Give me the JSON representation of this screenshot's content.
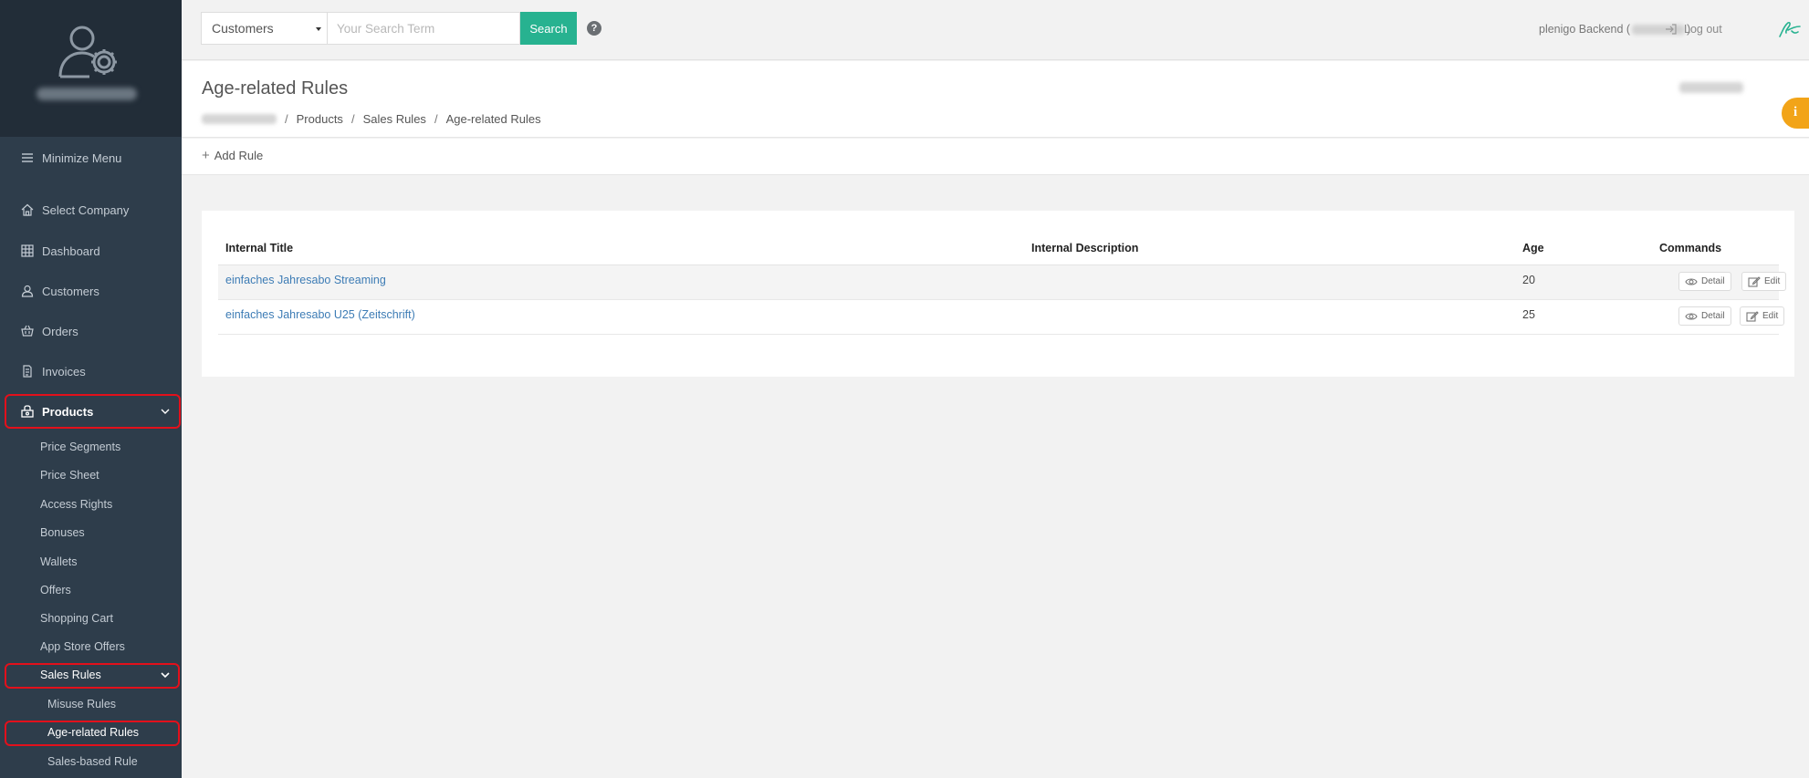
{
  "sidebar": {
    "minimize": "Minimize Menu",
    "items": [
      {
        "label": "Select Company",
        "icon": "home-icon"
      },
      {
        "label": "Dashboard",
        "icon": "grid-icon"
      },
      {
        "label": "Customers",
        "icon": "user-icon"
      },
      {
        "label": "Orders",
        "icon": "basket-icon"
      },
      {
        "label": "Invoices",
        "icon": "invoice-icon"
      },
      {
        "label": "Products",
        "icon": "products-icon"
      }
    ],
    "products_sub": [
      "Price Segments",
      "Price Sheet",
      "Access Rights",
      "Bonuses",
      "Wallets",
      "Offers",
      "Shopping Cart",
      "App Store Offers"
    ],
    "sales_rules": "Sales Rules",
    "sales_rules_sub": [
      "Misuse Rules",
      "Age-related Rules",
      "Sales-based Rule"
    ],
    "highlight_color": "#e3101b"
  },
  "topbar": {
    "search_scope": "Customers",
    "search_placeholder": "Your Search Term",
    "search_button": "Search",
    "help": "?",
    "account_prefix": "plenigo Backend (",
    "account_suffix": ")",
    "logout": "Log out",
    "accent": "#27b290"
  },
  "page": {
    "title": "Age-related Rules",
    "breadcrumb": [
      "Products",
      "Sales Rules",
      "Age-related Rules"
    ],
    "add_rule": "Add Rule",
    "info": "i"
  },
  "table": {
    "headers": [
      "Internal Title",
      "Internal Description",
      "Age",
      "Commands"
    ],
    "rows": [
      {
        "title": "einfaches Jahresabo Streaming",
        "description": "",
        "age": "20"
      },
      {
        "title": "einfaches Jahresabo U25 (Zeitschrift)",
        "description": "",
        "age": "25"
      }
    ],
    "detail": "Detail",
    "edit": "Edit"
  }
}
